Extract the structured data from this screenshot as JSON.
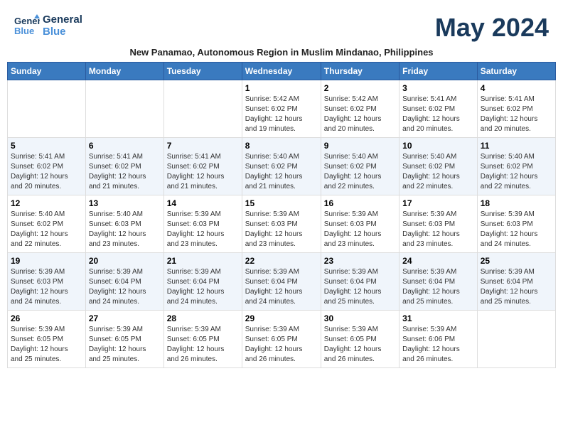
{
  "header": {
    "logo_line1": "General",
    "logo_line2": "Blue",
    "month_title": "May 2024",
    "subtitle": "New Panamao, Autonomous Region in Muslim Mindanao, Philippines"
  },
  "weekdays": [
    "Sunday",
    "Monday",
    "Tuesday",
    "Wednesday",
    "Thursday",
    "Friday",
    "Saturday"
  ],
  "weeks": [
    [
      {
        "day": "",
        "info": ""
      },
      {
        "day": "",
        "info": ""
      },
      {
        "day": "",
        "info": ""
      },
      {
        "day": "1",
        "info": "Sunrise: 5:42 AM\nSunset: 6:02 PM\nDaylight: 12 hours\nand 19 minutes."
      },
      {
        "day": "2",
        "info": "Sunrise: 5:42 AM\nSunset: 6:02 PM\nDaylight: 12 hours\nand 20 minutes."
      },
      {
        "day": "3",
        "info": "Sunrise: 5:41 AM\nSunset: 6:02 PM\nDaylight: 12 hours\nand 20 minutes."
      },
      {
        "day": "4",
        "info": "Sunrise: 5:41 AM\nSunset: 6:02 PM\nDaylight: 12 hours\nand 20 minutes."
      }
    ],
    [
      {
        "day": "5",
        "info": "Sunrise: 5:41 AM\nSunset: 6:02 PM\nDaylight: 12 hours\nand 20 minutes."
      },
      {
        "day": "6",
        "info": "Sunrise: 5:41 AM\nSunset: 6:02 PM\nDaylight: 12 hours\nand 21 minutes."
      },
      {
        "day": "7",
        "info": "Sunrise: 5:41 AM\nSunset: 6:02 PM\nDaylight: 12 hours\nand 21 minutes."
      },
      {
        "day": "8",
        "info": "Sunrise: 5:40 AM\nSunset: 6:02 PM\nDaylight: 12 hours\nand 21 minutes."
      },
      {
        "day": "9",
        "info": "Sunrise: 5:40 AM\nSunset: 6:02 PM\nDaylight: 12 hours\nand 22 minutes."
      },
      {
        "day": "10",
        "info": "Sunrise: 5:40 AM\nSunset: 6:02 PM\nDaylight: 12 hours\nand 22 minutes."
      },
      {
        "day": "11",
        "info": "Sunrise: 5:40 AM\nSunset: 6:02 PM\nDaylight: 12 hours\nand 22 minutes."
      }
    ],
    [
      {
        "day": "12",
        "info": "Sunrise: 5:40 AM\nSunset: 6:02 PM\nDaylight: 12 hours\nand 22 minutes."
      },
      {
        "day": "13",
        "info": "Sunrise: 5:40 AM\nSunset: 6:03 PM\nDaylight: 12 hours\nand 23 minutes."
      },
      {
        "day": "14",
        "info": "Sunrise: 5:39 AM\nSunset: 6:03 PM\nDaylight: 12 hours\nand 23 minutes."
      },
      {
        "day": "15",
        "info": "Sunrise: 5:39 AM\nSunset: 6:03 PM\nDaylight: 12 hours\nand 23 minutes."
      },
      {
        "day": "16",
        "info": "Sunrise: 5:39 AM\nSunset: 6:03 PM\nDaylight: 12 hours\nand 23 minutes."
      },
      {
        "day": "17",
        "info": "Sunrise: 5:39 AM\nSunset: 6:03 PM\nDaylight: 12 hours\nand 23 minutes."
      },
      {
        "day": "18",
        "info": "Sunrise: 5:39 AM\nSunset: 6:03 PM\nDaylight: 12 hours\nand 24 minutes."
      }
    ],
    [
      {
        "day": "19",
        "info": "Sunrise: 5:39 AM\nSunset: 6:03 PM\nDaylight: 12 hours\nand 24 minutes."
      },
      {
        "day": "20",
        "info": "Sunrise: 5:39 AM\nSunset: 6:04 PM\nDaylight: 12 hours\nand 24 minutes."
      },
      {
        "day": "21",
        "info": "Sunrise: 5:39 AM\nSunset: 6:04 PM\nDaylight: 12 hours\nand 24 minutes."
      },
      {
        "day": "22",
        "info": "Sunrise: 5:39 AM\nSunset: 6:04 PM\nDaylight: 12 hours\nand 24 minutes."
      },
      {
        "day": "23",
        "info": "Sunrise: 5:39 AM\nSunset: 6:04 PM\nDaylight: 12 hours\nand 25 minutes."
      },
      {
        "day": "24",
        "info": "Sunrise: 5:39 AM\nSunset: 6:04 PM\nDaylight: 12 hours\nand 25 minutes."
      },
      {
        "day": "25",
        "info": "Sunrise: 5:39 AM\nSunset: 6:04 PM\nDaylight: 12 hours\nand 25 minutes."
      }
    ],
    [
      {
        "day": "26",
        "info": "Sunrise: 5:39 AM\nSunset: 6:05 PM\nDaylight: 12 hours\nand 25 minutes."
      },
      {
        "day": "27",
        "info": "Sunrise: 5:39 AM\nSunset: 6:05 PM\nDaylight: 12 hours\nand 25 minutes."
      },
      {
        "day": "28",
        "info": "Sunrise: 5:39 AM\nSunset: 6:05 PM\nDaylight: 12 hours\nand 26 minutes."
      },
      {
        "day": "29",
        "info": "Sunrise: 5:39 AM\nSunset: 6:05 PM\nDaylight: 12 hours\nand 26 minutes."
      },
      {
        "day": "30",
        "info": "Sunrise: 5:39 AM\nSunset: 6:05 PM\nDaylight: 12 hours\nand 26 minutes."
      },
      {
        "day": "31",
        "info": "Sunrise: 5:39 AM\nSunset: 6:06 PM\nDaylight: 12 hours\nand 26 minutes."
      },
      {
        "day": "",
        "info": ""
      }
    ]
  ]
}
